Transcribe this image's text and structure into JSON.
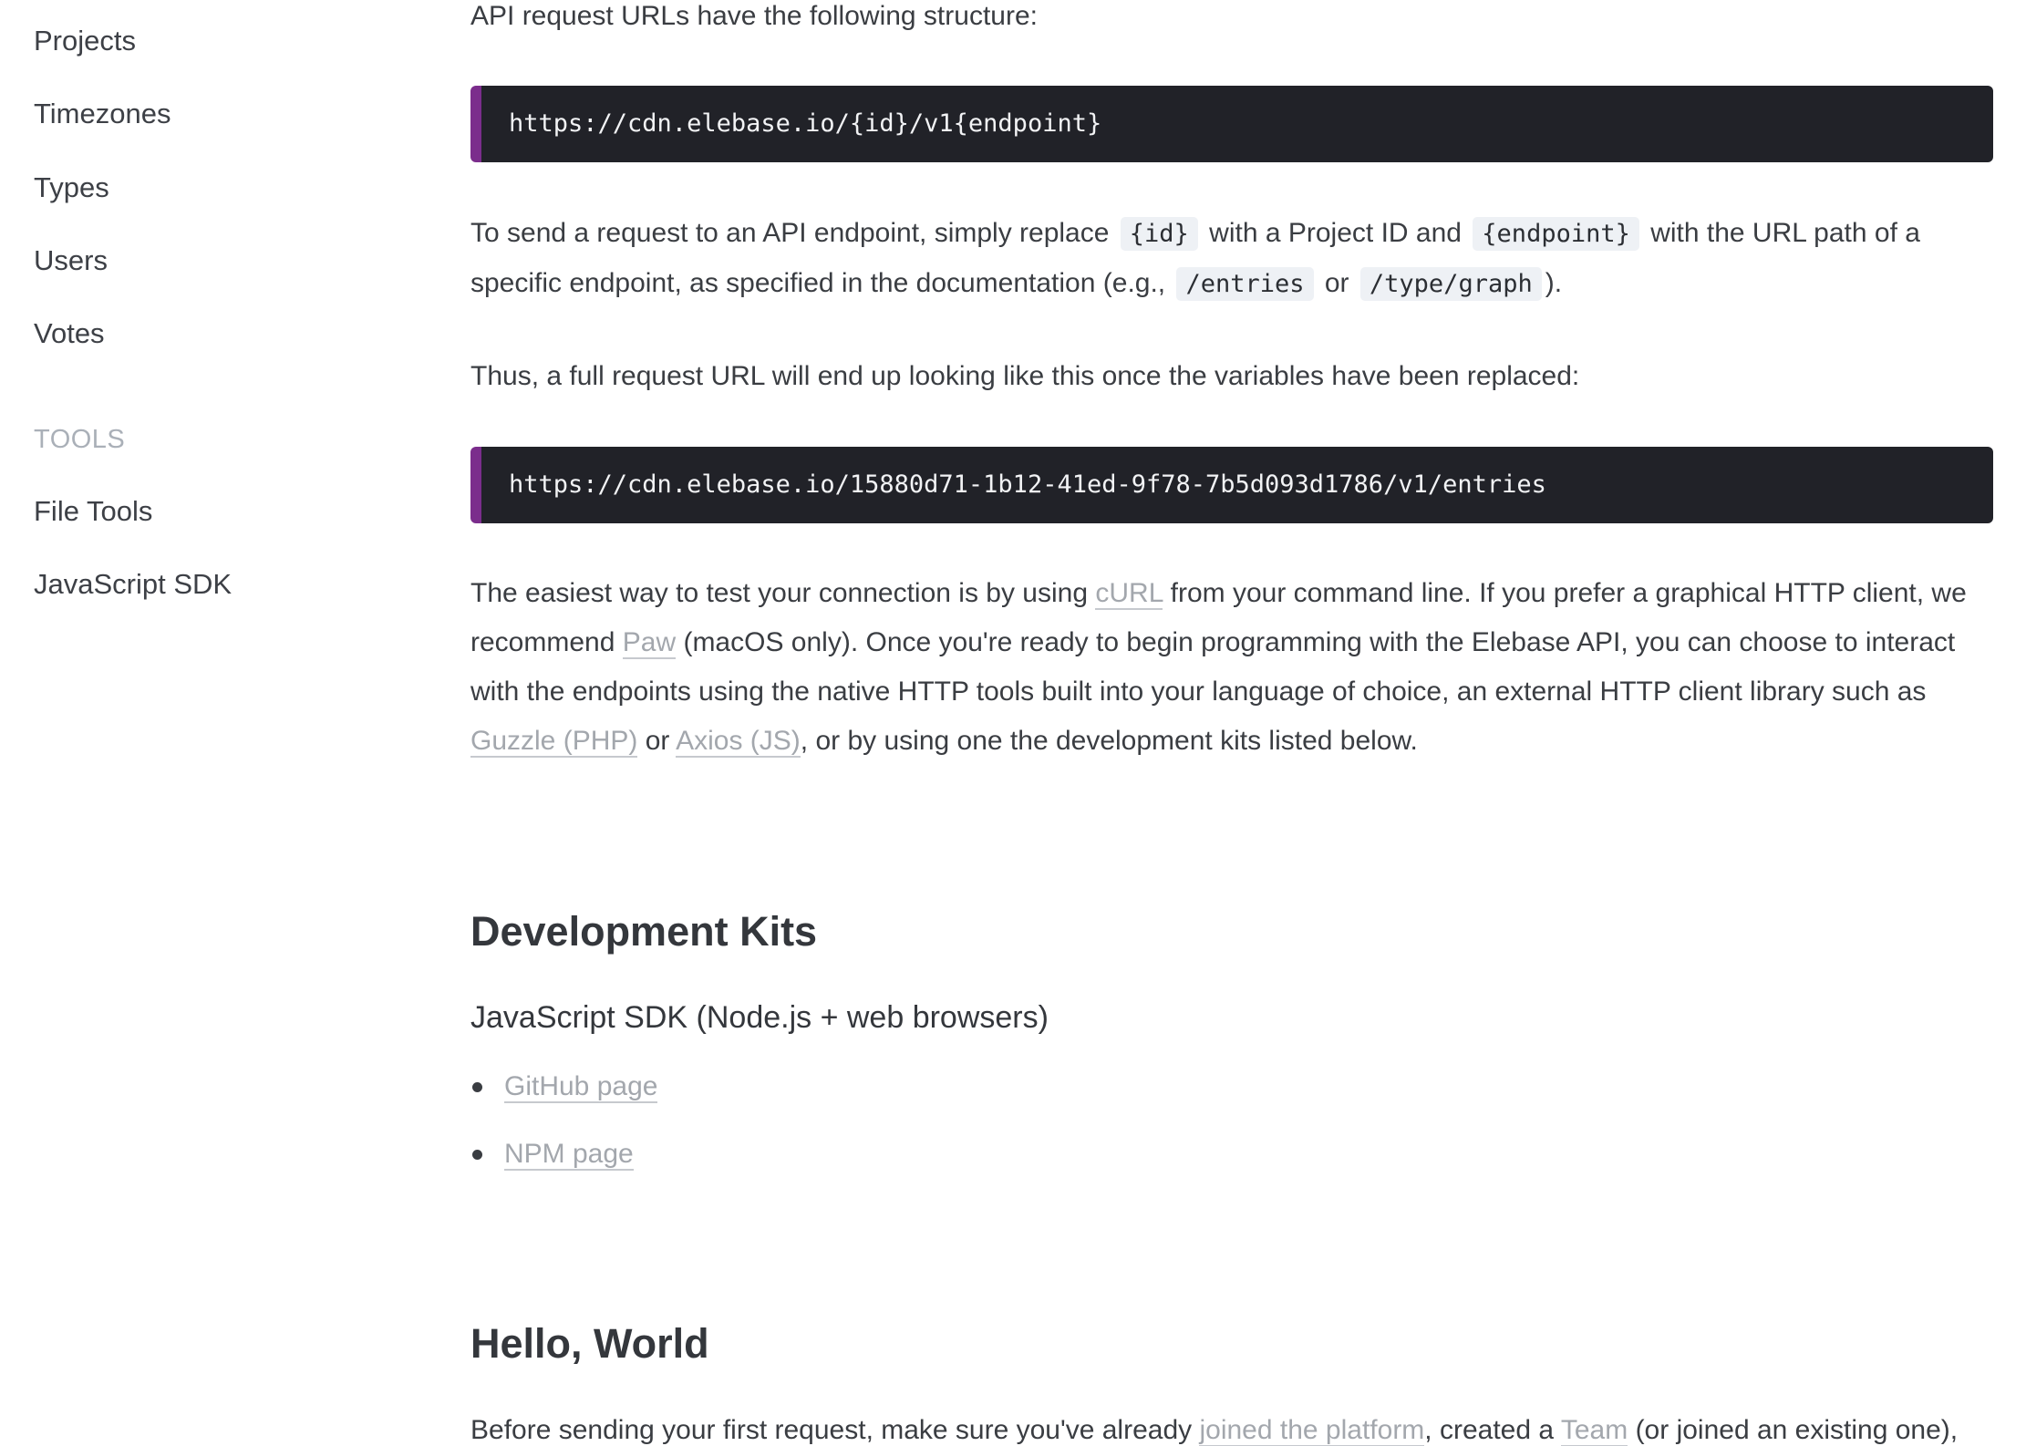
{
  "sidebar": {
    "items": [
      {
        "label": "Projects"
      },
      {
        "label": "Timezones"
      },
      {
        "label": "Types"
      },
      {
        "label": "Users"
      },
      {
        "label": "Votes"
      }
    ],
    "tools_heading": "TOOLS",
    "tool_items": [
      {
        "label": "File Tools"
      },
      {
        "label": "JavaScript SDK"
      }
    ]
  },
  "main": {
    "url_structure_intro": "API request URLs have the following structure:",
    "url_structure_code": "https://cdn.elebase.io/{id}/v1{endpoint}",
    "replace_para": {
      "t1": "To send a request to an API endpoint, simply replace",
      "code_id": "{id}",
      "t2": "with a Project ID and",
      "code_endpoint": "{endpoint}",
      "t3": "with the URL path of a specific endpoint, as specified in the documentation (e.g.,",
      "code_entries": "/entries",
      "t4": "or",
      "code_type_graph": "/type/graph",
      "t5": ")."
    },
    "full_url_intro": "Thus, a full request URL will end up looking like this once the variables have been replaced:",
    "full_url_code": "https://cdn.elebase.io/15880d71-1b12-41ed-9f78-7b5d093d1786/v1/entries",
    "testing_para": {
      "t1": "The easiest way to test your connection is by using",
      "link_curl": "cURL",
      "t2": "from your command line. If you prefer a graphical HTTP client, we recommend",
      "link_paw": "Paw",
      "t3": "(macOS only). Once you're ready to begin programming with the Elebase API, you can choose to interact with the endpoints using the native HTTP tools built into your language of choice, an external HTTP client library such as",
      "link_guzzle": "Guzzle (PHP)",
      "t4": "or",
      "link_axios": "Axios (JS)",
      "t5": ", or by using one the development kits listed below."
    },
    "dev_kits": {
      "heading": "Development Kits",
      "subheading": "JavaScript SDK (Node.js + web browsers)",
      "links": [
        {
          "label": "GitHub page"
        },
        {
          "label": "NPM page"
        }
      ]
    },
    "hello_world": {
      "heading": "Hello, World",
      "t1": "Before sending your first request, make sure you've already",
      "link_joined": "joined the platform",
      "t2": ", created a",
      "link_team": "Team",
      "t3": "(or joined an existing one),"
    }
  },
  "colors": {
    "code_block_bg": "#212228",
    "code_block_accent": "#7b2d8c",
    "link": "#a3a7ad",
    "inline_code_bg": "#eef1f5",
    "muted_heading": "#aab0b8"
  }
}
